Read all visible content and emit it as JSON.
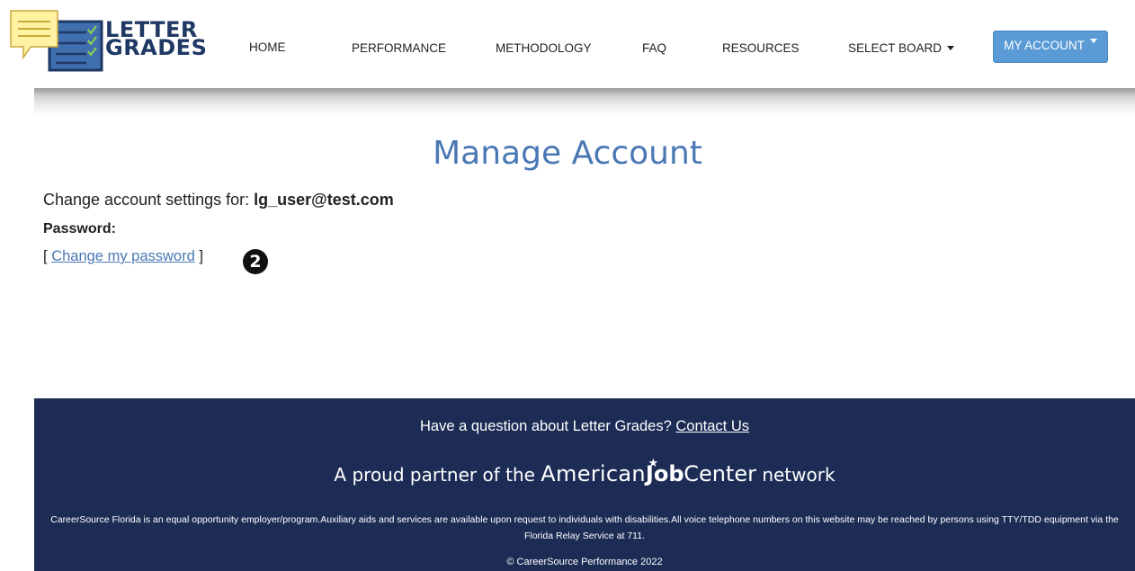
{
  "logo": {
    "line1": "LETTER",
    "line2": "GRADES",
    "icon": "checklist-icon"
  },
  "nav": {
    "home": "HOME",
    "performance": "PERFORMANCE",
    "methodology": "METHODOLOGY",
    "faq": "FAQ",
    "resources": "RESOURCES",
    "select_board": "SELECT BOARD",
    "my_account": "MY ACCOUNT"
  },
  "main": {
    "title": "Manage Account",
    "settings_prefix": "Change account settings for:",
    "user_email": "lg_user@test.com",
    "password_label": "Password:",
    "bracket_open": "[",
    "change_password_link": "Change my password",
    "bracket_close": "]",
    "step_badge": "2"
  },
  "footer": {
    "question": "Have a question about Letter Grades?",
    "contact_link": "Contact Us",
    "partner_prefix": "A proud partner of the",
    "ajc_american": "American",
    "ajc_job": "Job",
    "ajc_center": "Center",
    "partner_suffix": "network",
    "eeo_text": "CareerSource Florida is an equal opportunity employer/program.Auxiliary aids and services are available upon request to individuals with disabilities.All voice telephone numbers on this website may be reached by persons using TTY/TDD equipment via the Florida Relay Service at 711.",
    "copyright": "© CareerSource Performance 2022"
  },
  "colors": {
    "accent": "#4a78b4",
    "button": "#5b9bd5",
    "footer_bg": "#1c2c55",
    "logo_text": "#1f3864"
  }
}
